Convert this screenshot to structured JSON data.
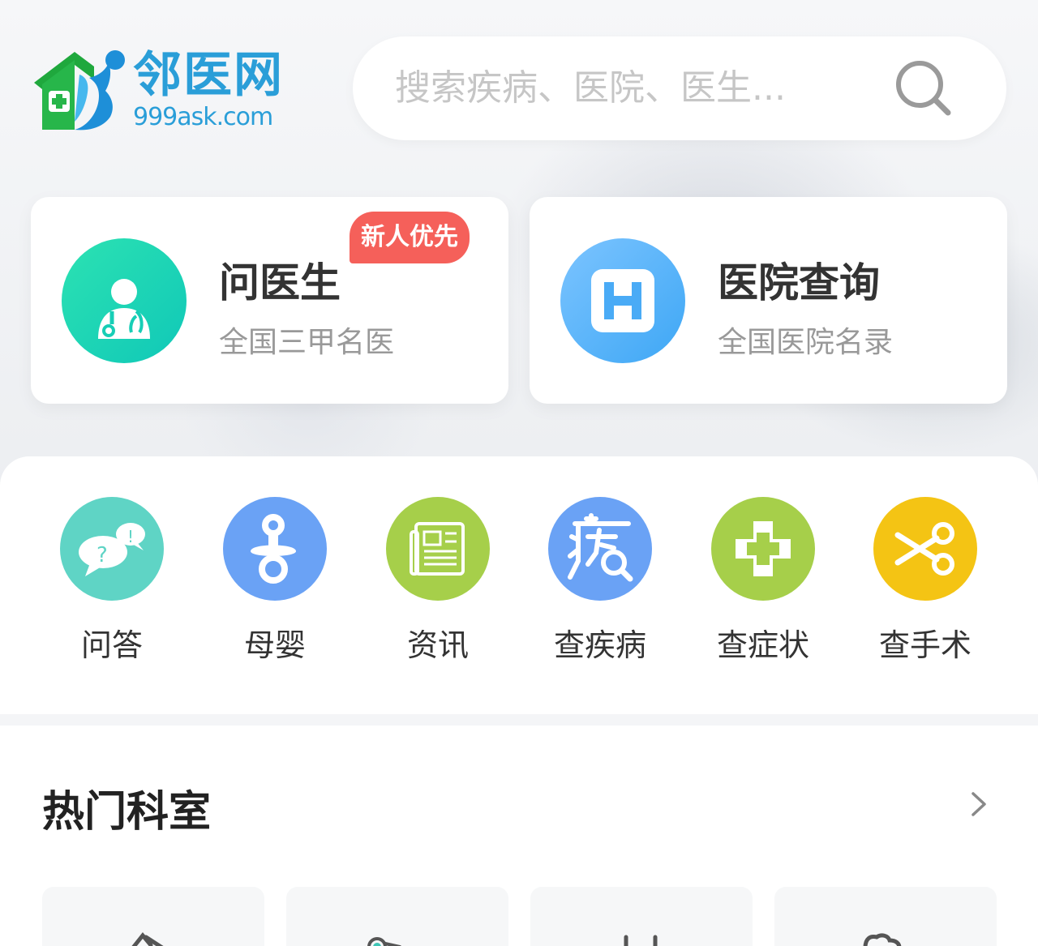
{
  "header": {
    "logo_title": "邻医网",
    "logo_subtitle": "999ask.com",
    "search_placeholder": "搜索疾病、医院、医生..."
  },
  "cards": [
    {
      "title": "问医生",
      "subtitle": "全国三甲名医",
      "badge": "新人优先",
      "icon": "doctor-icon"
    },
    {
      "title": "医院查询",
      "subtitle": "全国医院名录",
      "icon": "hospital-icon"
    }
  ],
  "quick_menu": [
    {
      "label": "问答",
      "icon": "qa-bubble-icon",
      "color": "#5fd4c5"
    },
    {
      "label": "母婴",
      "icon": "pacifier-icon",
      "color": "#6aa2f5"
    },
    {
      "label": "资讯",
      "icon": "newspaper-icon",
      "color": "#a6cf4a"
    },
    {
      "label": "查疾病",
      "icon": "disease-search-icon",
      "color": "#6aa2f5"
    },
    {
      "label": "查症状",
      "icon": "medical-cross-icon",
      "color": "#a6cf4a"
    },
    {
      "label": "查手术",
      "icon": "scissors-icon",
      "color": "#f4c414"
    }
  ],
  "departments": {
    "title": "热门科室",
    "more_icon": "chevron-right-icon"
  },
  "colors": {
    "brand": "#2a9ed8",
    "badge": "#f5605a"
  }
}
